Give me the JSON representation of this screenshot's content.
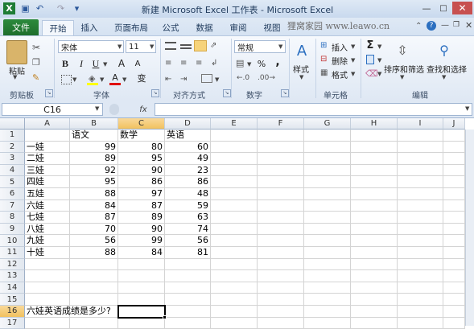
{
  "window": {
    "title": "新建 Microsoft Excel 工作表 - Microsoft Excel",
    "watermark": "狸窝家园 www.leawo.cn"
  },
  "ribbon": {
    "tabs": [
      "文件",
      "开始",
      "插入",
      "页面布局",
      "公式",
      "数据",
      "审阅",
      "视图"
    ],
    "active_tab": "开始",
    "clipboard": {
      "paste_label": "粘贴",
      "group_label": "剪贴板"
    },
    "font": {
      "name": "宋体",
      "size": "11",
      "group_label": "字体",
      "bold": "B",
      "italic": "I",
      "underline": "U",
      "grow": "A",
      "shrink": "A",
      "color_a": "A",
      "wen": "变"
    },
    "alignment": {
      "group_label": "对齐方式"
    },
    "number": {
      "format": "常规",
      "percent": "%",
      "comma": ",",
      "group_label": "数字"
    },
    "styles": {
      "label": "样式"
    },
    "cells": {
      "insert": "插入",
      "delete": "删除",
      "format": "格式",
      "group_label": "单元格"
    },
    "editing": {
      "sort_filter": "排序和筛选",
      "find_select": "查找和选择",
      "group_label": "编辑",
      "sigma": "Σ"
    }
  },
  "formula_bar": {
    "name_box": "C16",
    "fx": "fx",
    "content": ""
  },
  "sheet": {
    "columns": [
      "A",
      "B",
      "C",
      "D",
      "E",
      "F",
      "G",
      "H",
      "I",
      "J"
    ],
    "selected_column": "C",
    "selected_row": "16",
    "rows": [
      "1",
      "2",
      "3",
      "4",
      "5",
      "6",
      "7",
      "8",
      "9",
      "10",
      "11",
      "12",
      "13",
      "14",
      "15",
      "16",
      "17"
    ],
    "headers": [
      "语文",
      "数学",
      "英语"
    ],
    "data": [
      {
        "name": "一娃",
        "v": [
          "99",
          "80",
          "60"
        ]
      },
      {
        "name": "二娃",
        "v": [
          "89",
          "95",
          "49"
        ]
      },
      {
        "name": "三娃",
        "v": [
          "92",
          "90",
          "23"
        ]
      },
      {
        "name": "四娃",
        "v": [
          "95",
          "86",
          "86"
        ]
      },
      {
        "name": "五娃",
        "v": [
          "88",
          "97",
          "48"
        ]
      },
      {
        "name": "六娃",
        "v": [
          "84",
          "87",
          "59"
        ]
      },
      {
        "name": "七娃",
        "v": [
          "87",
          "89",
          "63"
        ]
      },
      {
        "name": "八娃",
        "v": [
          "70",
          "90",
          "74"
        ]
      },
      {
        "name": "九娃",
        "v": [
          "56",
          "99",
          "56"
        ]
      },
      {
        "name": "十娃",
        "v": [
          "88",
          "84",
          "81"
        ]
      }
    ],
    "question": "六娃英语成绩是多少?"
  }
}
